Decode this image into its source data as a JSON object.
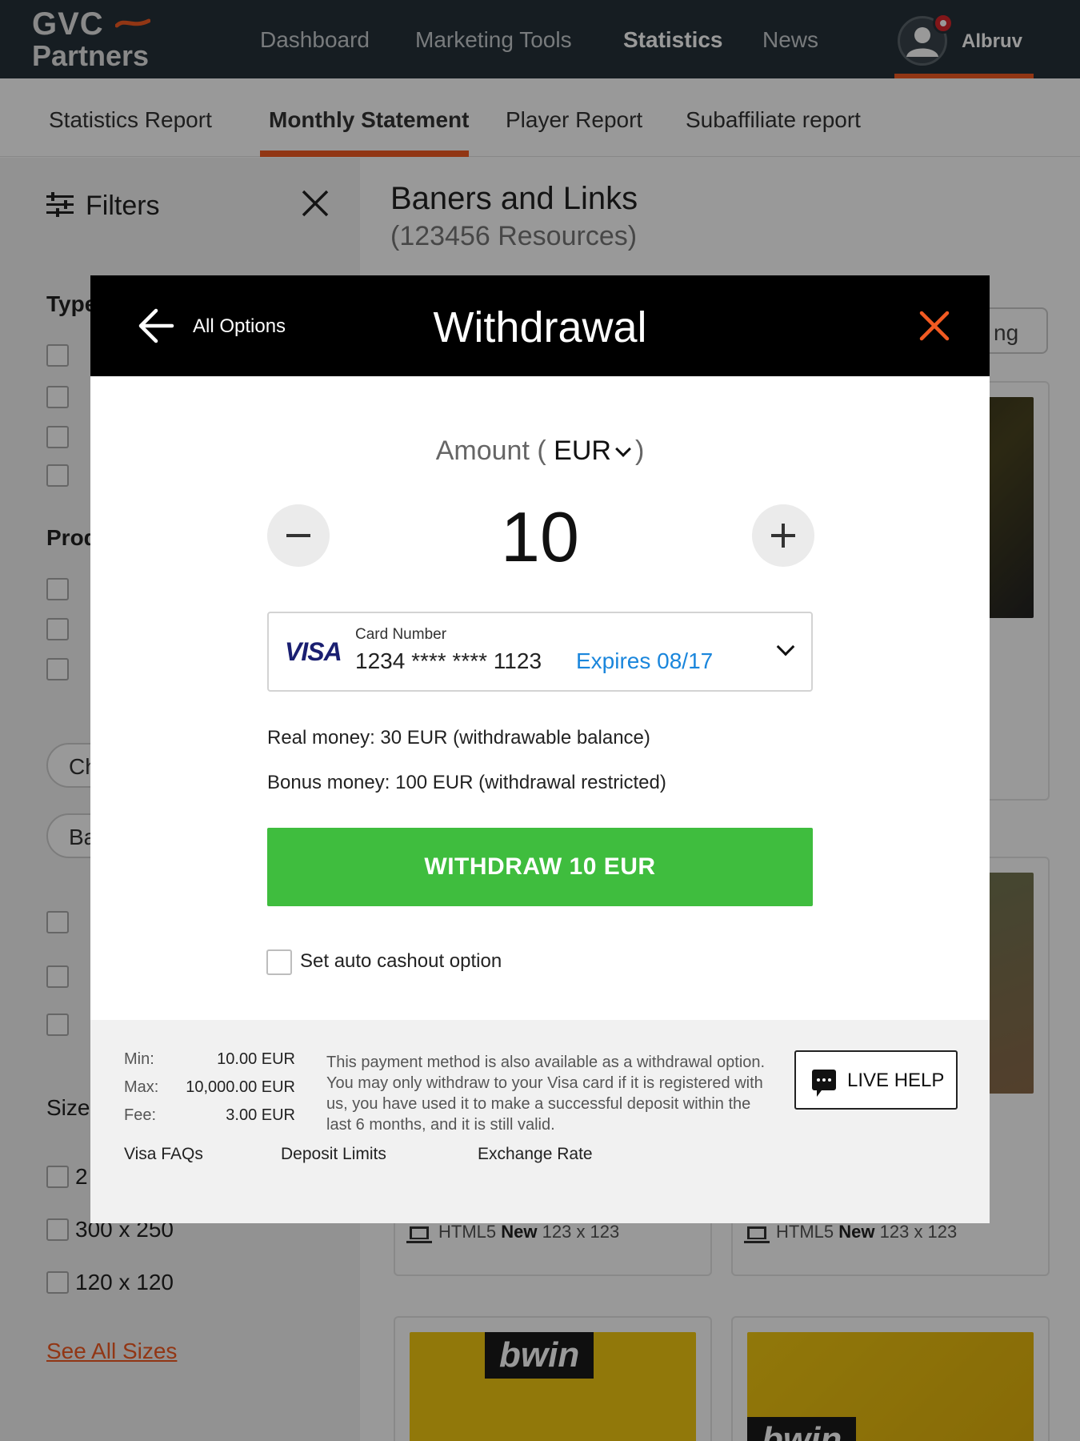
{
  "header": {
    "logo_line1": "GVC",
    "logo_line2": "Partners",
    "nav": [
      "Dashboard",
      "Marketing Tools",
      "Statistics",
      "News"
    ],
    "active_nav": "Statistics",
    "user_name": "Albruv"
  },
  "subtabs": [
    "Statistics Report",
    "Monthly Statement",
    "Player Report",
    "Subaffiliate report"
  ],
  "sidebar": {
    "title": "Filters",
    "type_label": "Type",
    "product_label": "Prod",
    "chip1": "Ch",
    "chip2": "Ba",
    "size_label": "Size",
    "size_partial": "2",
    "size_options": [
      "300 x 250",
      "120 x 120"
    ],
    "see_all": "See All Sizes"
  },
  "content": {
    "title": "Baners and Links",
    "subtitle": "(123456 Resources)",
    "sort_partial": "ng",
    "card_meta_format": "HTML5",
    "card_meta_badge": "New",
    "card_meta_size": "123 x 123",
    "brand": "bwin"
  },
  "modal": {
    "back_label": "All Options",
    "title": "Withdrawal",
    "amount_label": "Amount (",
    "amount_close": ")",
    "currency": "EUR",
    "amount": "10",
    "card_label": "Card Number",
    "card_brand": "VISA",
    "card_number": "1234  **** **** 1123",
    "card_expiry": "Expires 08/17",
    "real_money": "Real money: 30 EUR (withdrawable balance)",
    "bonus_money": "Bonus money: 100 EUR (withdrawal restricted)",
    "withdraw_button": "WITHDRAW 10 EUR",
    "auto_cashout": "Set auto cashout option",
    "limits": {
      "min_label": "Min:",
      "min_value": "10.00 EUR",
      "max_label": "Max:",
      "max_value": "10,000.00 EUR",
      "fee_label": "Fee:",
      "fee_value": "3.00 EUR"
    },
    "info_line1": "This payment method is also available as a withdrawal option.",
    "info_line2": "You may only withdraw to your Visa card if it is registered with us, you have used it to make a successful deposit within the last 6 months, and it is still valid.",
    "live_help": "LIVE HELP",
    "links": [
      "Visa FAQs",
      "Deposit Limits",
      "Exchange Rate"
    ]
  },
  "colors": {
    "topbar": "#263139",
    "accent": "#f25a22",
    "success": "#3fbd3e",
    "link_blue": "#1a86dc",
    "visa_blue": "#1a1f71"
  }
}
